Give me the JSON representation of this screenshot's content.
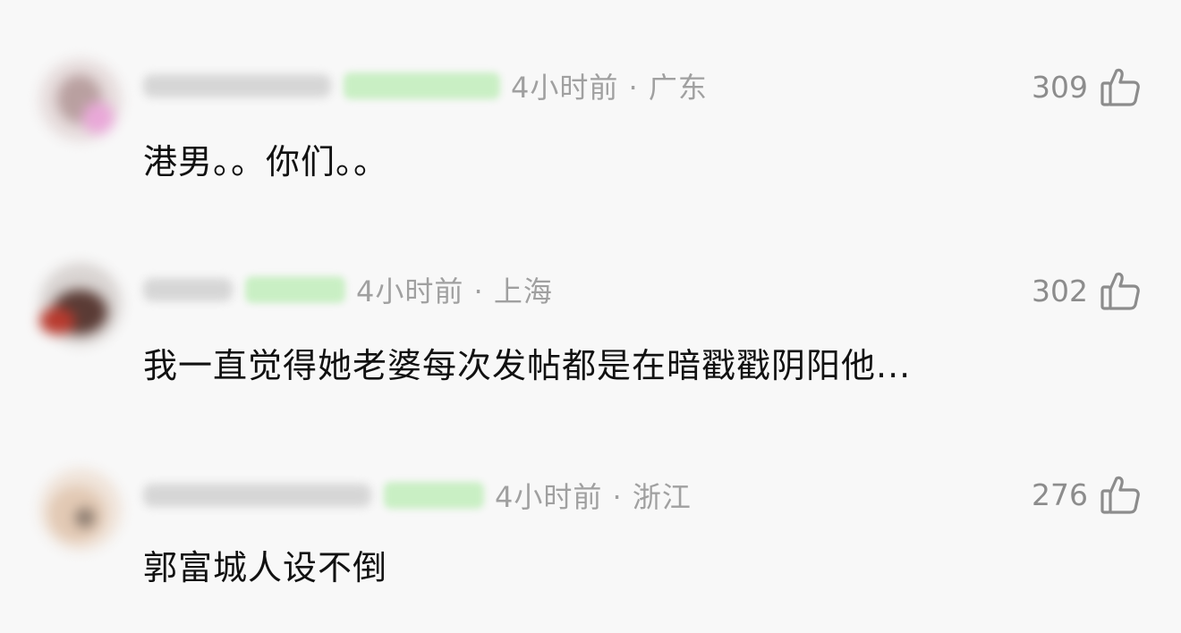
{
  "comments": [
    {
      "meta": "4小时前 · 广东",
      "content": "港男。。你们。。",
      "likes": "309",
      "like_icon": "thumbs-up-icon"
    },
    {
      "meta": "4小时前 · 上海",
      "content": "我一直觉得她老婆每次发帖都是在暗戳戳阴阳他...",
      "likes": "302",
      "like_icon": "thumbs-up-icon"
    },
    {
      "meta": "4小时前 · 浙江",
      "content": "郭富城人设不倒",
      "likes": "276",
      "like_icon": "thumbs-up-icon"
    }
  ],
  "colors": {
    "background": "#f8f8f8",
    "meta_text": "#a0a0a0",
    "content_text": "#111111",
    "like_count": "#8c8c8c",
    "badge_green": "#c9efc4"
  }
}
